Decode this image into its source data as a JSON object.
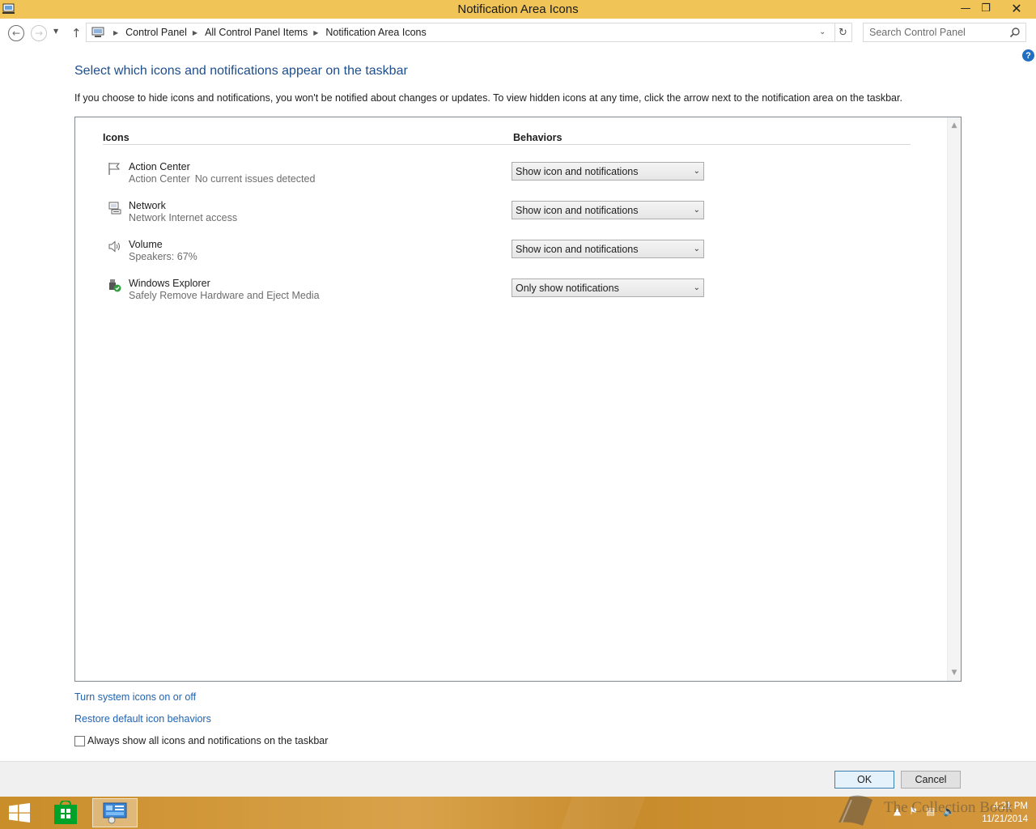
{
  "window": {
    "title": "Notification Area Icons"
  },
  "nav": {
    "breadcrumbs": [
      "Control Panel",
      "All Control Panel Items",
      "Notification Area Icons"
    ],
    "search_placeholder": "Search Control Panel"
  },
  "content": {
    "heading": "Select which icons and notifications appear on the taskbar",
    "description": "If you choose to hide icons and notifications, you won't be notified about changes or updates. To view hidden icons at any time, click the arrow next to the notification area on the taskbar.",
    "columns": {
      "icons": "Icons",
      "behaviors": "Behaviors"
    },
    "rows": [
      {
        "name": "Action Center",
        "desc_a": "Action Center",
        "desc_b": "No current issues detected",
        "behavior": "Show icon and notifications",
        "icon": "flag-icon"
      },
      {
        "name": "Network",
        "desc_a": "Network Internet access",
        "desc_b": "",
        "behavior": "Show icon and notifications",
        "icon": "network-icon"
      },
      {
        "name": "Volume",
        "desc_a": "Speakers: 67%",
        "desc_b": "",
        "behavior": "Show icon and notifications",
        "icon": "speaker-icon"
      },
      {
        "name": "Windows Explorer",
        "desc_a": "Safely Remove Hardware and Eject Media",
        "desc_b": "",
        "behavior": "Only show notifications",
        "icon": "usb-eject-icon"
      }
    ],
    "links": {
      "system_icons": "Turn system icons on or off",
      "restore": "Restore default icon behaviors"
    },
    "checkbox_label": "Always show all icons and notifications on the taskbar",
    "checkbox_checked": false
  },
  "footer": {
    "ok": "OK",
    "cancel": "Cancel"
  },
  "taskbar": {
    "time": "4:21 PM",
    "date": "11/21/2014",
    "watermark": "The Collection Book"
  },
  "colors": {
    "titlebar": "#f0c456",
    "link": "#1e63b4",
    "heading": "#1e4e8c"
  }
}
